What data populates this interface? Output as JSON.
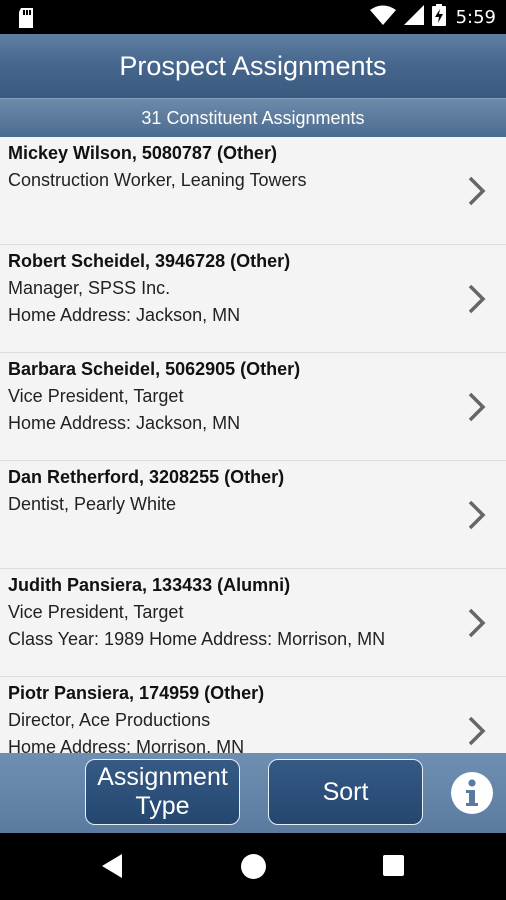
{
  "status": {
    "time": "5:59"
  },
  "header": {
    "title": "Prospect Assignments",
    "subtitle": "31 Constituent Assignments"
  },
  "assignments": [
    {
      "name": "Mickey Wilson, 5080787 (Other)",
      "line2": "Construction Worker, Leaning Towers",
      "line3": ""
    },
    {
      "name": "Robert Scheidel, 3946728 (Other)",
      "line2": "Manager, SPSS Inc.",
      "line3": "Home Address: Jackson, MN"
    },
    {
      "name": "Barbara Scheidel, 5062905 (Other)",
      "line2": "Vice President, Target",
      "line3": "Home Address: Jackson, MN"
    },
    {
      "name": "Dan Retherford, 3208255 (Other)",
      "line2": "Dentist, Pearly White",
      "line3": ""
    },
    {
      "name": "Judith Pansiera, 133433 (Alumni)",
      "line2": "Vice President, Target",
      "line3": "Class Year: 1989  Home Address: Morrison, MN"
    },
    {
      "name": "Piotr Pansiera, 174959 (Other)",
      "line2": "Director, Ace Productions",
      "line3": "Home Address: Morrison, MN"
    }
  ],
  "toolbar": {
    "assignment_type_line1": "Assignment",
    "assignment_type_line2": "Type",
    "sort_label": "Sort"
  },
  "colors": {
    "header_bg": "#45658c",
    "toolbar_bg": "#6384aa",
    "button_bg": "#2b4d77"
  },
  "icons": {
    "status_left": "sd-card-icon",
    "wifi": "wifi-icon",
    "signal": "signal-icon",
    "battery": "battery-charging-icon",
    "row_chevron": "chevron-right-icon",
    "info": "info-icon",
    "nav_back": "back-icon",
    "nav_home": "home-icon",
    "nav_recent": "recent-apps-icon"
  }
}
